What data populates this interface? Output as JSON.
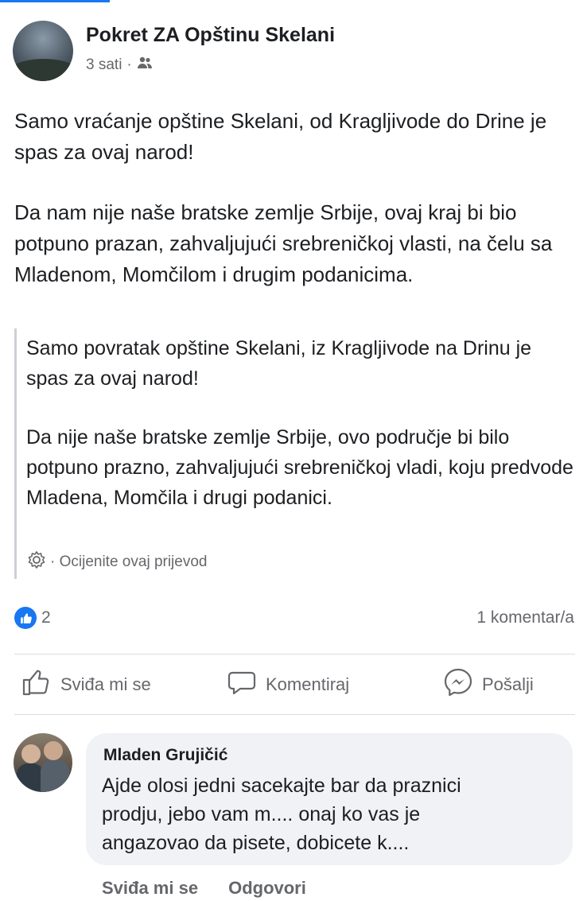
{
  "post": {
    "page_name": "Pokret ZA Opštinu Skelani",
    "time": "3 sati",
    "separator": "·",
    "audience_icon": "friends-icon",
    "text": [
      "Samo vraćanje opštine Skelani, od Kragljivode do Drine je spas za ovaj narod!",
      "Da nam nije naše bratske zemlje Srbije, ovaj kraj bi bio potpuno prazan, zahvaljujući srebreničkoj vlasti, na čelu sa Mladenom, Momčilom i drugim podanicima."
    ],
    "translation": [
      "Samo povratak opštine Skelani, iz Kragljivode na Drinu je spas za ovaj narod!",
      "Da nije naše bratske zemlje Srbije, ovo područje bi bilo potpuno prazno, zahvaljujući srebreničkoj vladi, koju predvode Mladena, Momčila i drugi podanici."
    ],
    "rate_translation": "· Ocijenite ovaj prijevod",
    "reaction_count": "2",
    "comment_count": "1 komentar/a"
  },
  "actions": {
    "like": "Sviđa mi se",
    "comment": "Komentiraj",
    "send": "Pošalji"
  },
  "comment": {
    "author": "Mladen Grujičić",
    "text_lines": [
      "Ajde olosi jedni sacekajte bar da praznici",
      "prodju, jebo vam m.... onaj ko vas je",
      "angazovao da pisete, dobicete k...."
    ],
    "like": "Sviđa mi se",
    "reply": "Odgovori"
  },
  "colors": {
    "accent": "#1877f2",
    "secondary_text": "#65676b",
    "bubble": "#f0f2f5"
  }
}
